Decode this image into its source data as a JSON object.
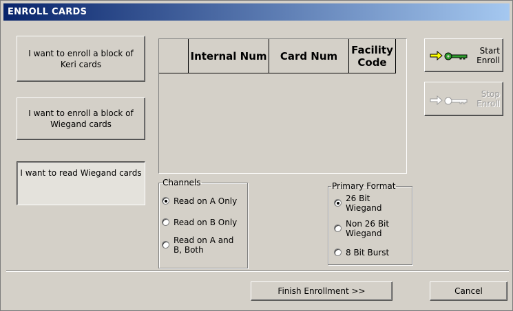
{
  "window": {
    "title": "ENROLL CARDS"
  },
  "left_buttons": [
    {
      "label": "I want to enroll a block of Keri cards"
    },
    {
      "label": "I want to enroll a block of Wiegand cards"
    },
    {
      "label": "I want to read Wiegand cards"
    }
  ],
  "grid": {
    "columns": [
      "",
      "Internal Num",
      "Card Num",
      "Facility Code"
    ],
    "rows": []
  },
  "channels": {
    "legend": "Channels",
    "options": [
      "Read on A Only",
      "Read on B Only",
      "Read on A and B, Both"
    ],
    "selected": "Read on A Only"
  },
  "primary_format": {
    "legend": "Primary Format",
    "options": [
      "26 Bit Wiegand",
      "Non 26 Bit Wiegand",
      "8 Bit Burst"
    ],
    "selected": "26 Bit Wiegand"
  },
  "right_buttons": {
    "start": {
      "label": "Start Enroll",
      "icon": "arrow-key-icon",
      "enabled": true
    },
    "stop": {
      "label": "Stop Enroll",
      "icon": "arrow-key-icon",
      "enabled": false
    }
  },
  "footer": {
    "finish_label": "Finish Enrollment >>",
    "cancel_label": "Cancel"
  }
}
